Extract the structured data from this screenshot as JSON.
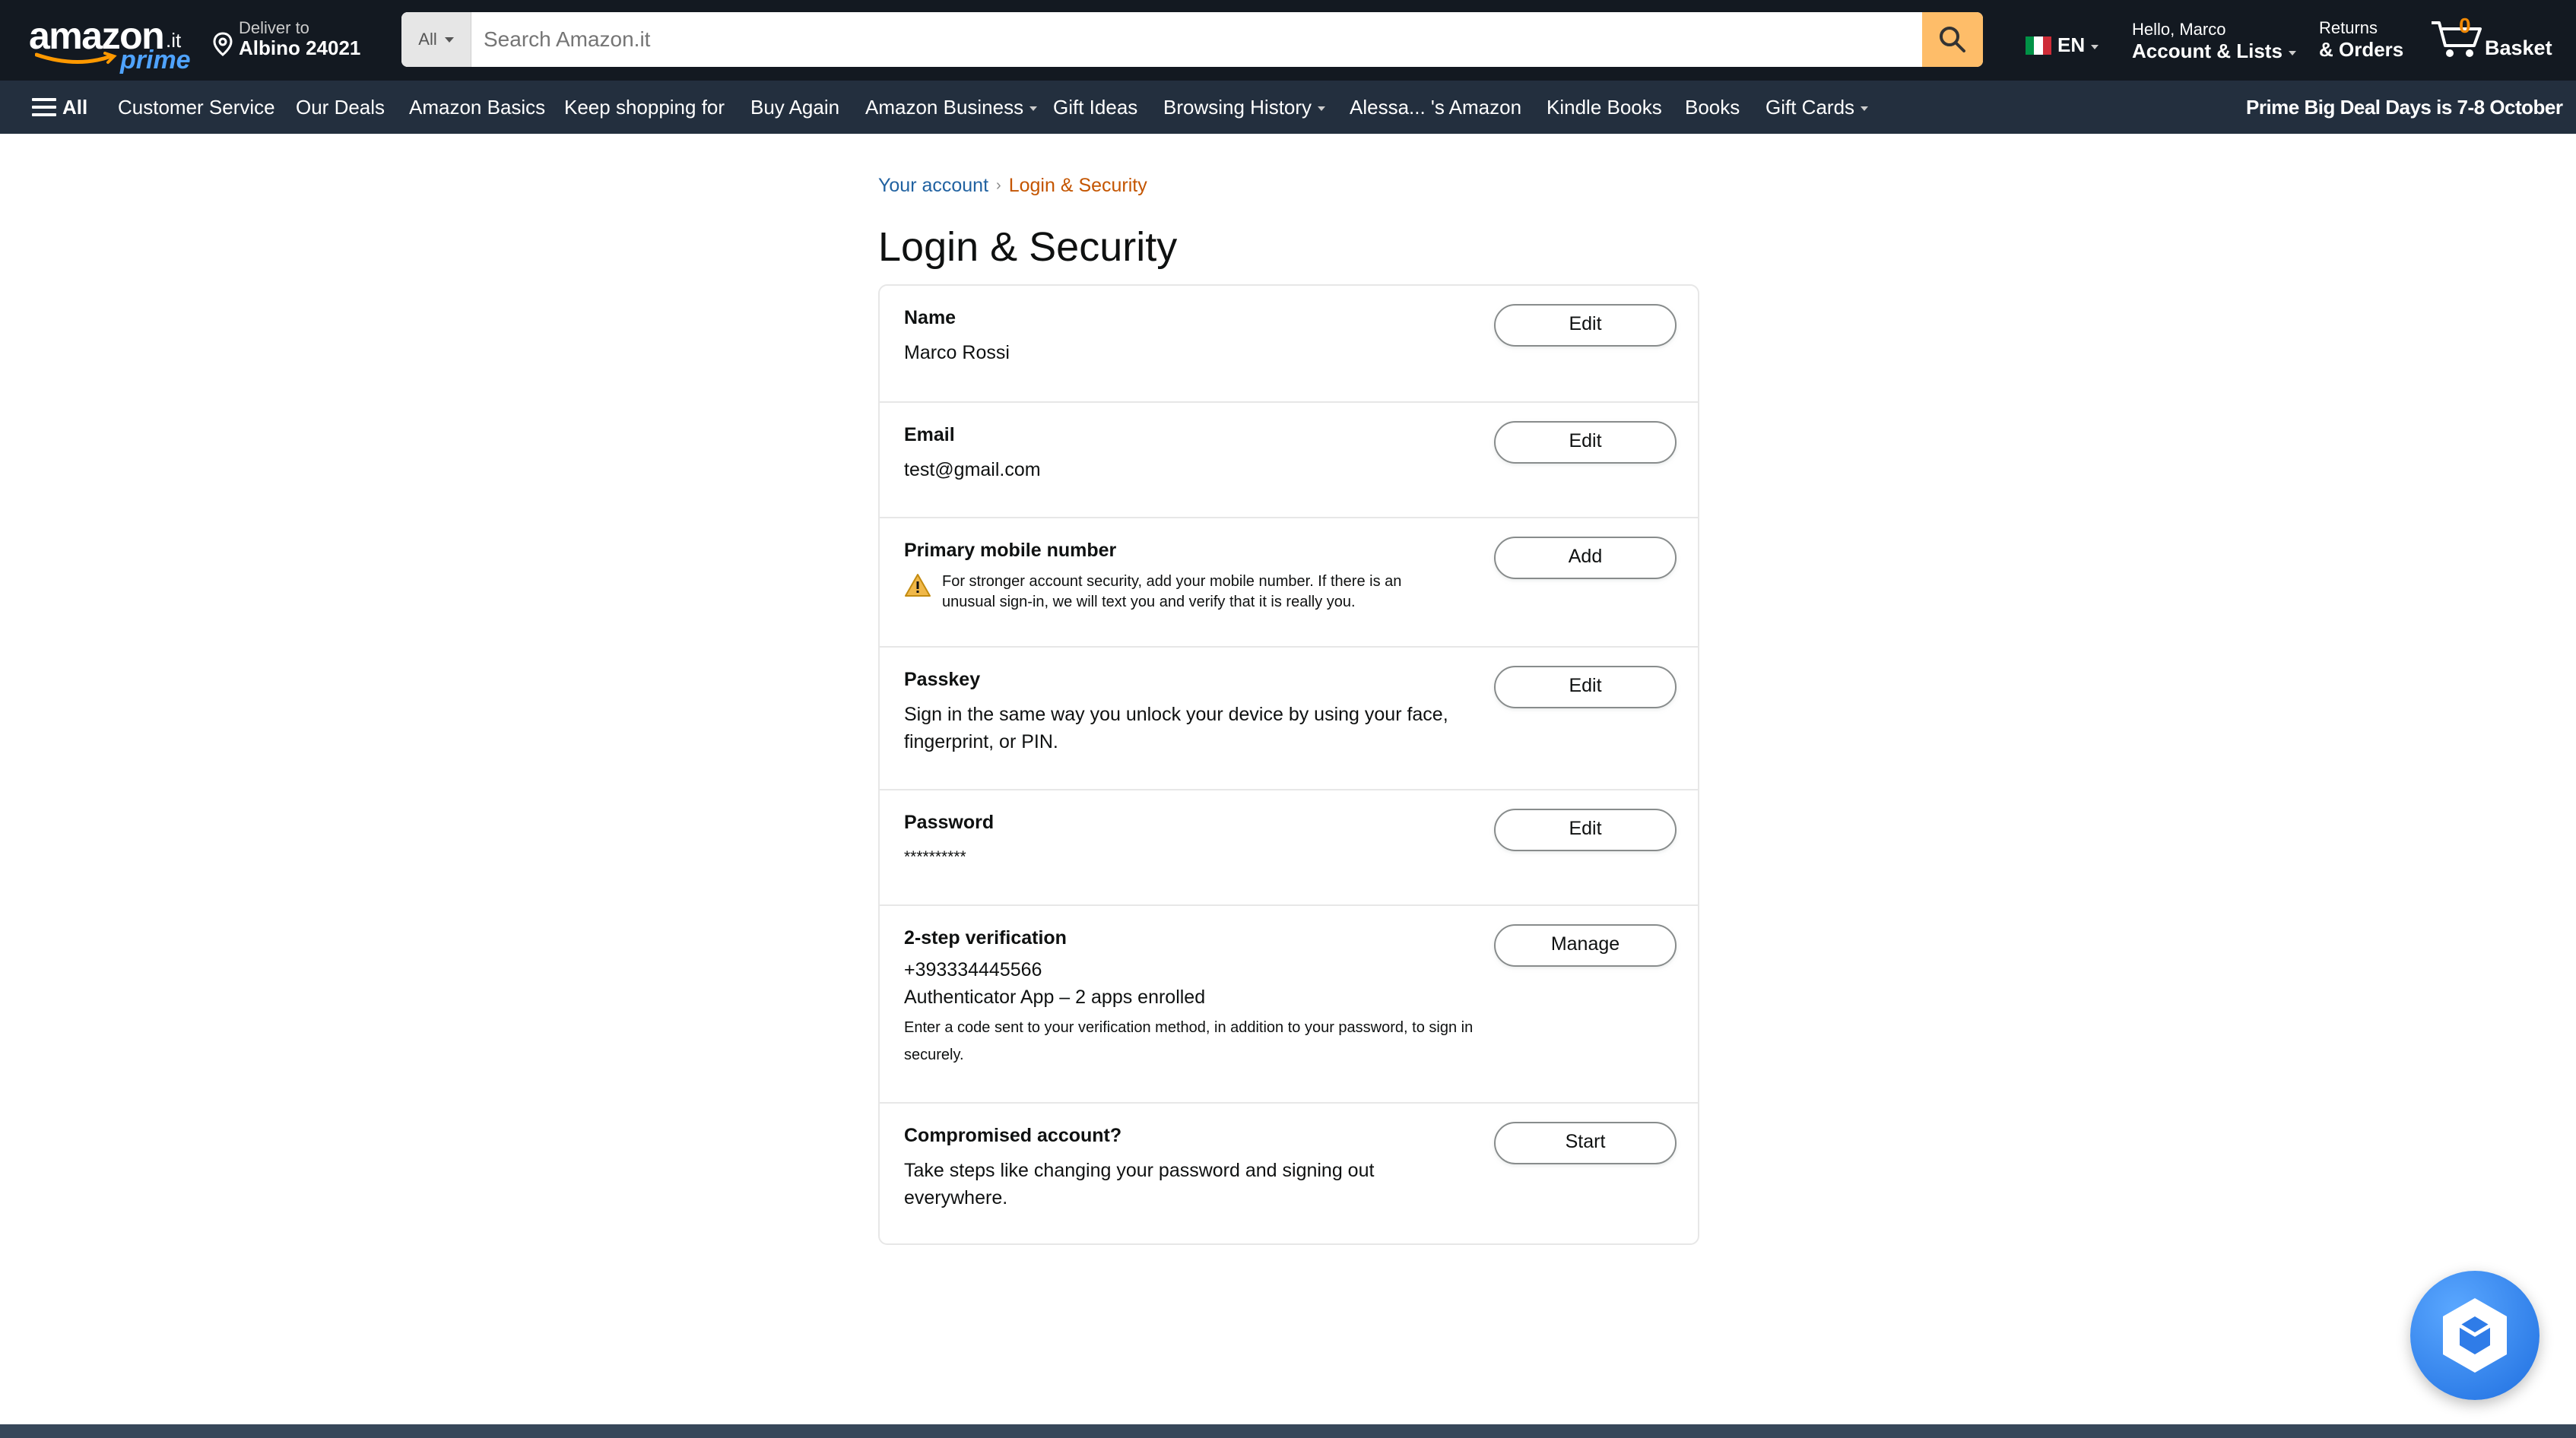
{
  "header": {
    "logo": {
      "word": "amazon",
      "tld": ".it",
      "prime": "prime"
    },
    "deliver": {
      "line1": "Deliver to",
      "line2": "Albino 24021"
    },
    "search": {
      "category": "All",
      "placeholder": "Search Amazon.it"
    },
    "language": "EN",
    "account": {
      "greeting": "Hello, Marco",
      "label": "Account & Lists"
    },
    "returns": {
      "line1": "Returns",
      "line2": "& Orders"
    },
    "basket": {
      "count": "0",
      "label": "Basket"
    }
  },
  "subnav": {
    "all": "All",
    "items": [
      "Customer Service",
      "Our Deals",
      "Amazon Basics",
      "Keep shopping for",
      "Buy Again",
      "Amazon Business",
      "Gift Ideas",
      "Browsing History",
      "Alessa... 's Amazon",
      "Kindle Books",
      "Books",
      "Gift Cards"
    ],
    "promo": "Prime Big Deal Days is 7-8 October"
  },
  "breadcrumb": {
    "parent": "Your account",
    "current": "Login & Security"
  },
  "page_title": "Login & Security",
  "rows": {
    "name": {
      "label": "Name",
      "value": "Marco Rossi",
      "button": "Edit"
    },
    "email": {
      "label": "Email",
      "value": "test@gmail.com",
      "button": "Edit"
    },
    "mobile": {
      "label": "Primary mobile number",
      "warning_line1": "For stronger account security, add your mobile number. If there is an",
      "warning_line2": "unusual sign-in, we will text you and verify that it is really you.",
      "button": "Add"
    },
    "passkey": {
      "label": "Passkey",
      "value": "Sign in the same way you unlock your device by using your face, fingerprint, or PIN.",
      "button": "Edit"
    },
    "password": {
      "label": "Password",
      "value": "**********",
      "button": "Edit"
    },
    "twostep": {
      "label": "2-step verification",
      "phone": "+393334445566",
      "app": "Authenticator App – 2 apps enrolled",
      "desc": "Enter a code sent to your verification method, in addition to your password, to sign in securely.",
      "button": "Manage"
    },
    "compromised": {
      "label": "Compromised account?",
      "value": "Take steps like changing your password and signing out everywhere.",
      "button": "Start"
    }
  },
  "colors": {
    "nav": "#131921",
    "subnav": "#232f3e",
    "search_button": "#febd69",
    "link": "#2162a1",
    "breadcrumb_current": "#c45500"
  }
}
